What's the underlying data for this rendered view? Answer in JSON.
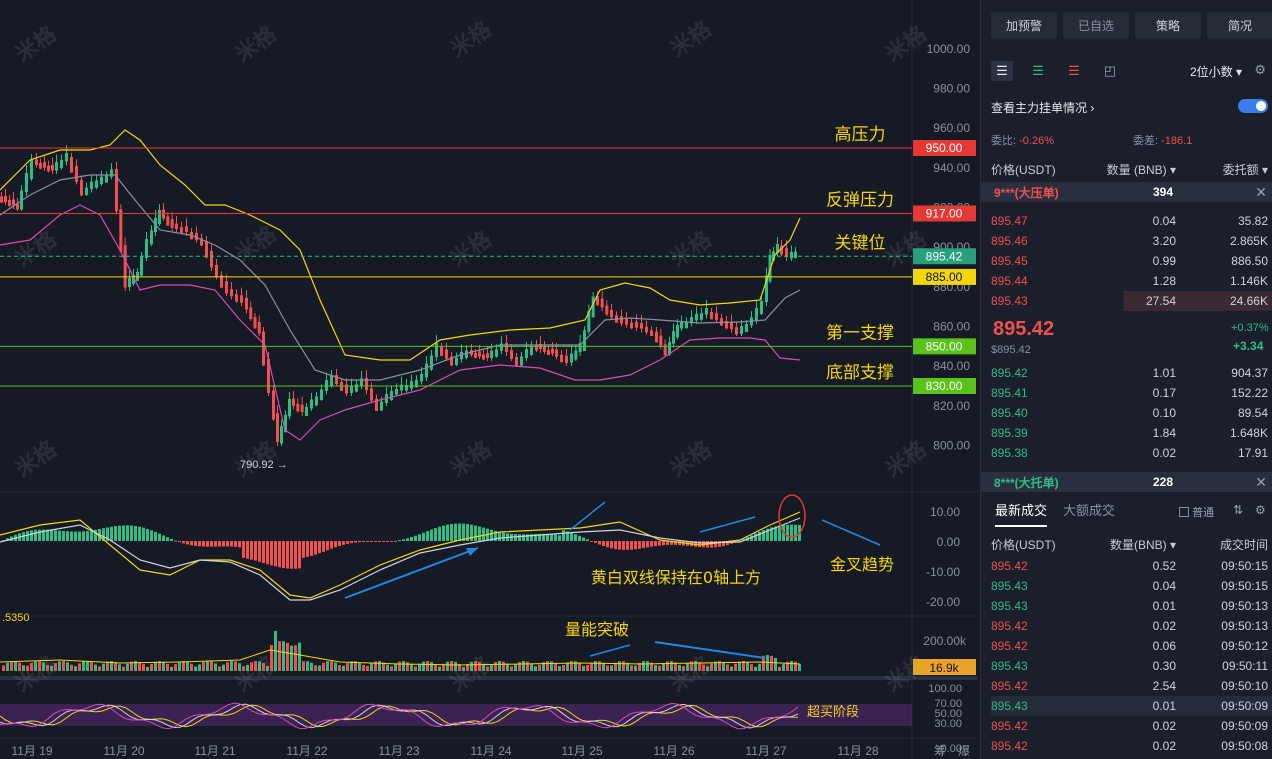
{
  "chart": {
    "price_axis": [
      "1000.00",
      "980.00",
      "960.00",
      "940.00",
      "920.00",
      "900.00",
      "880.00",
      "860.00",
      "840.00",
      "820.00",
      "800.00"
    ],
    "macd_axis": [
      "10.00",
      "0.00",
      "-10.00",
      "-20.00"
    ],
    "volume_axis": [
      "200.00k"
    ],
    "volume_value": "16.9k",
    "rsi_axis": [
      "100.00",
      "70.00",
      "50.00",
      "30.00",
      "0.00"
    ],
    "left_value": ".5350",
    "low_label": "790.92 →",
    "x_labels": [
      "11月 19",
      "11月 20",
      "11月 21",
      "11月 22",
      "11月 23",
      "11月 24",
      "11月 25",
      "11月 26",
      "11月 27",
      "11月 28"
    ],
    "corner_labels": [
      "筹",
      "爆"
    ],
    "watermark": "米格",
    "level_lines": [
      {
        "label": "高压力",
        "value": "950.00",
        "tag_color": "#e53935",
        "line_color": "#e53935"
      },
      {
        "label": "反弹压力",
        "value": "917.00",
        "tag_color": "#e53935",
        "line_color": "#e53935"
      },
      {
        "label": "关键位",
        "value": "895.42",
        "tag_color": "#26a17b",
        "line_color": "#2ebd85"
      },
      {
        "label": "",
        "value": "885.00",
        "tag_color": "#f5d60a",
        "line_color": "#f5d60a"
      },
      {
        "label": "第一支撑",
        "value": "850.00",
        "tag_color": "#5ac21a",
        "line_color": "#5ac21a"
      },
      {
        "label": "底部支撑",
        "value": "830.00",
        "tag_color": "#5ac21a",
        "line_color": "#5ac21a"
      }
    ],
    "annotations": {
      "macd_text": "黄白双线保持在0轴上方",
      "golden_cross": "金叉趋势",
      "volume_break": "量能突破",
      "overbought": "超买阶段"
    }
  },
  "panel": {
    "top_buttons": [
      "加预警",
      "已自选",
      "策略",
      "简况"
    ],
    "decimals": "2位小数",
    "view_main_orders": "查看主力挂单情况",
    "ratio_label": "委比:",
    "ratio_value": "-0.26%",
    "diff_label": "委差:",
    "diff_value": "-186.1",
    "headers": {
      "price": "价格(USDT)",
      "qty": "数量 (BNB)",
      "amount": "委托额"
    },
    "big_sell": {
      "label": "9***(大压单)",
      "count": "394"
    },
    "asks": [
      {
        "price": "895.47",
        "qty": "0.04",
        "amount": "35.82"
      },
      {
        "price": "895.46",
        "qty": "3.20",
        "amount": "2.865K"
      },
      {
        "price": "895.45",
        "qty": "0.99",
        "amount": "886.50"
      },
      {
        "price": "895.44",
        "qty": "1.28",
        "amount": "1.146K"
      },
      {
        "price": "895.43",
        "qty": "27.54",
        "amount": "24.66K"
      }
    ],
    "last_price": "895.42",
    "last_price_usd": "$895.42",
    "change_pct": "+0.37%",
    "change_abs": "+3.34",
    "bids": [
      {
        "price": "895.42",
        "qty": "1.01",
        "amount": "904.37"
      },
      {
        "price": "895.41",
        "qty": "0.17",
        "amount": "152.22"
      },
      {
        "price": "895.40",
        "qty": "0.10",
        "amount": "89.54"
      },
      {
        "price": "895.39",
        "qty": "1.84",
        "amount": "1.648K"
      },
      {
        "price": "895.38",
        "qty": "0.02",
        "amount": "17.91"
      }
    ],
    "big_buy": {
      "label": "8***(大托单)",
      "count": "228"
    },
    "tabs": [
      "最新成交",
      "大额成交"
    ],
    "normal_label": "普通",
    "trades_headers": {
      "price": "价格(USDT)",
      "qty": "数量(BNB)",
      "time": "成交时间"
    },
    "trades": [
      {
        "price": "895.42",
        "qty": "0.52",
        "time": "09:50:15",
        "side": "sell"
      },
      {
        "price": "895.43",
        "qty": "0.04",
        "time": "09:50:15",
        "side": "buy"
      },
      {
        "price": "895.43",
        "qty": "0.01",
        "time": "09:50:13",
        "side": "buy"
      },
      {
        "price": "895.42",
        "qty": "0.02",
        "time": "09:50:13",
        "side": "sell"
      },
      {
        "price": "895.42",
        "qty": "0.06",
        "time": "09:50:12",
        "side": "sell"
      },
      {
        "price": "895.43",
        "qty": "0.30",
        "time": "09:50:11",
        "side": "buy"
      },
      {
        "price": "895.42",
        "qty": "2.54",
        "time": "09:50:10",
        "side": "sell"
      },
      {
        "price": "895.43",
        "qty": "0.01",
        "time": "09:50:09",
        "side": "buy"
      },
      {
        "price": "895.42",
        "qty": "0.02",
        "time": "09:50:09",
        "side": "sell"
      },
      {
        "price": "895.42",
        "qty": "0.02",
        "time": "09:50:08",
        "side": "sell"
      }
    ]
  }
}
